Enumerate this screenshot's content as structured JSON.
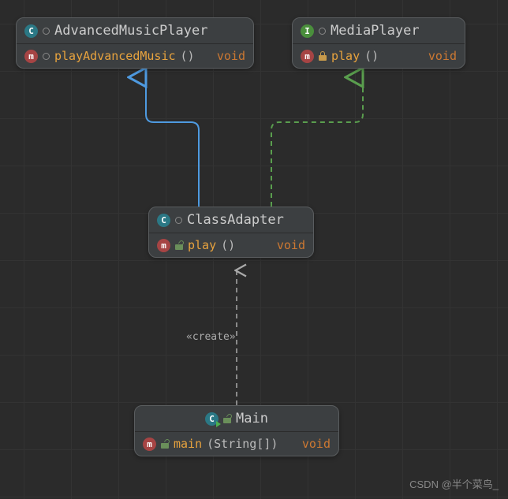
{
  "nodes": {
    "advanced": {
      "title": "AdvancedMusicPlayer",
      "badge": "C",
      "method": {
        "name": "playAdvancedMusic",
        "params": "()",
        "ret": "void",
        "badge": "m"
      }
    },
    "media": {
      "title": "MediaPlayer",
      "badge": "I",
      "method": {
        "name": "play",
        "params": "()",
        "ret": "void",
        "badge": "m"
      }
    },
    "adapter": {
      "title": "ClassAdapter",
      "badge": "C",
      "method": {
        "name": "play",
        "params": "()",
        "ret": "void",
        "badge": "m"
      }
    },
    "main": {
      "title": "Main",
      "badge": "C",
      "method": {
        "name": "main",
        "params": "(String[])",
        "ret": "void",
        "badge": "m"
      }
    }
  },
  "stereotype": "«create»",
  "watermark": "CSDN @半个菜鸟_",
  "relations": [
    {
      "from": "ClassAdapter",
      "to": "AdvancedMusicPlayer",
      "style": "extends"
    },
    {
      "from": "ClassAdapter",
      "to": "MediaPlayer",
      "style": "implements"
    },
    {
      "from": "Main",
      "to": "ClassAdapter",
      "style": "create"
    }
  ]
}
